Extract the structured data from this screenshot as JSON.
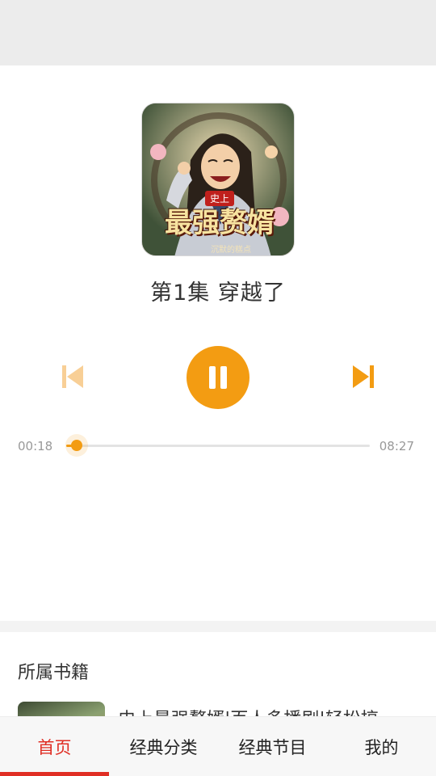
{
  "player": {
    "episode_title": "第1集 穿越了",
    "cover": {
      "badge": "史上",
      "title": "最强赘婿",
      "author": "沉默的糕点"
    },
    "time_current": "00:18",
    "time_total": "08:27",
    "progress_fraction": 0.035,
    "state": "playing",
    "accent_color": "#f39c12"
  },
  "book": {
    "section_title": "所属书籍",
    "name": "史上最强赘婿|百人多播剧|轻松搞"
  },
  "nav": {
    "items": [
      {
        "label": "首页",
        "active": true
      },
      {
        "label": "经典分类",
        "active": false
      },
      {
        "label": "经典节目",
        "active": false
      },
      {
        "label": "我的",
        "active": false
      }
    ],
    "active_color": "#e02e24"
  }
}
